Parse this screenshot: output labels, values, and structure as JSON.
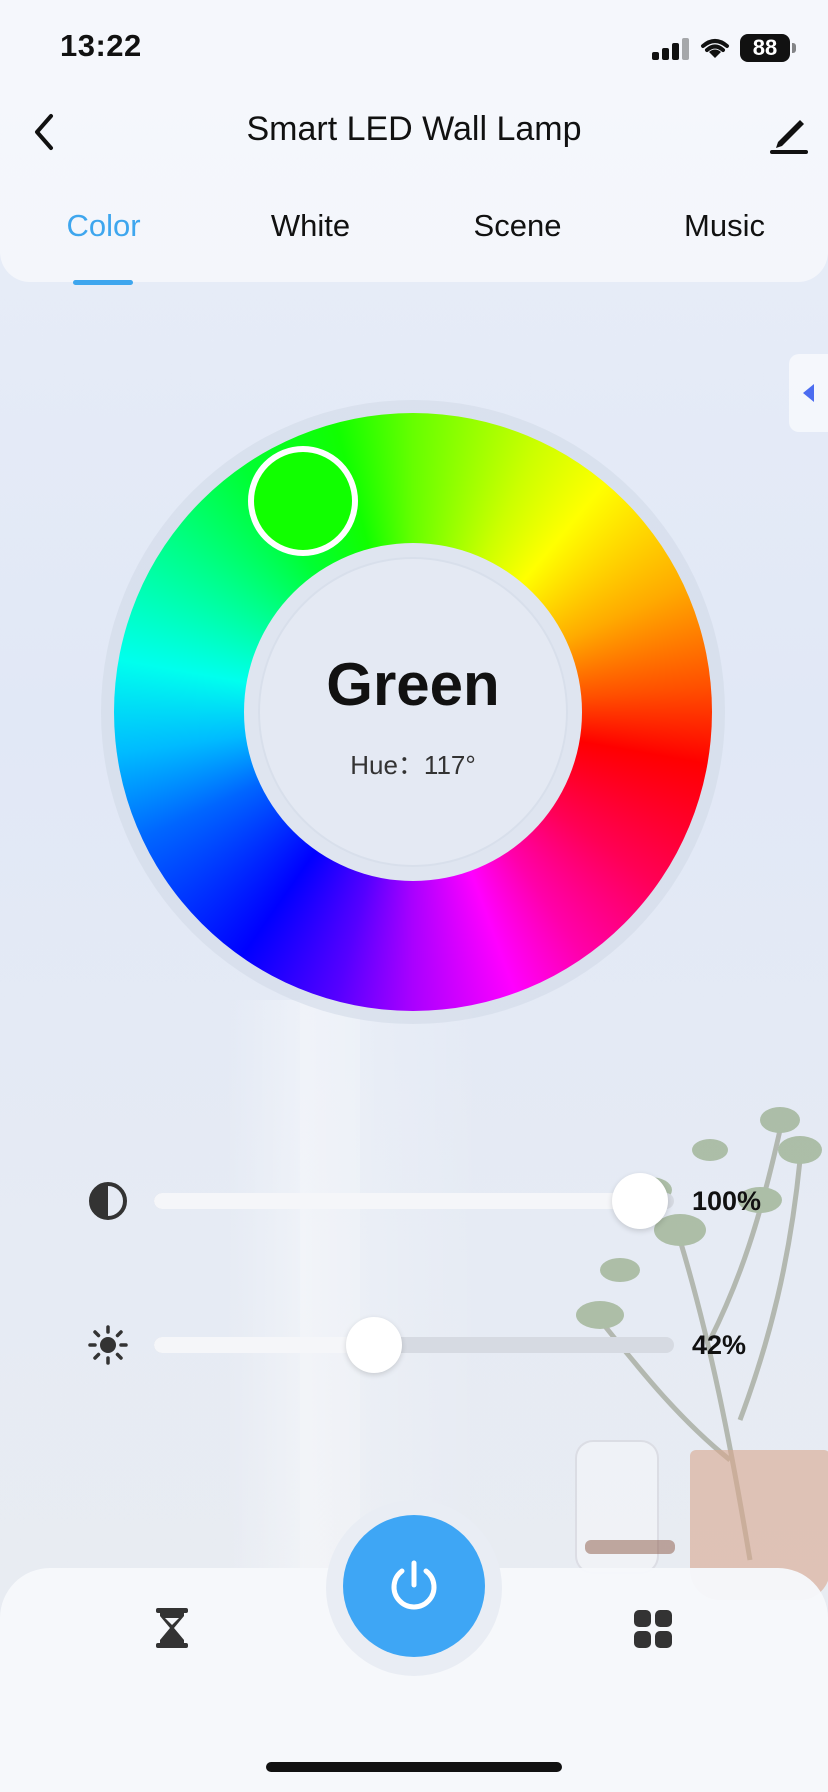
{
  "status_bar": {
    "time": "13:22",
    "battery": "88"
  },
  "header": {
    "title": "Smart LED Wall Lamp"
  },
  "tabs": [
    {
      "label": "Color",
      "active": true
    },
    {
      "label": "White",
      "active": false
    },
    {
      "label": "Scene",
      "active": false
    },
    {
      "label": "Music",
      "active": false
    }
  ],
  "color_wheel": {
    "color_name": "Green",
    "hue_label": "Hue：",
    "hue_value": "117°"
  },
  "sliders": {
    "saturation": {
      "icon": "contrast-icon",
      "value": 1.0,
      "label": "100%"
    },
    "brightness": {
      "icon": "brightness-icon",
      "value": 0.42,
      "label": "42%"
    }
  },
  "bottom_bar": {
    "left_icon": "timer-icon",
    "center_icon": "power-icon",
    "right_icon": "grid-icon"
  },
  "colors": {
    "accent": "#3ea6ee",
    "power_button": "#3ea6f5",
    "selected_color": "#11ff00"
  }
}
